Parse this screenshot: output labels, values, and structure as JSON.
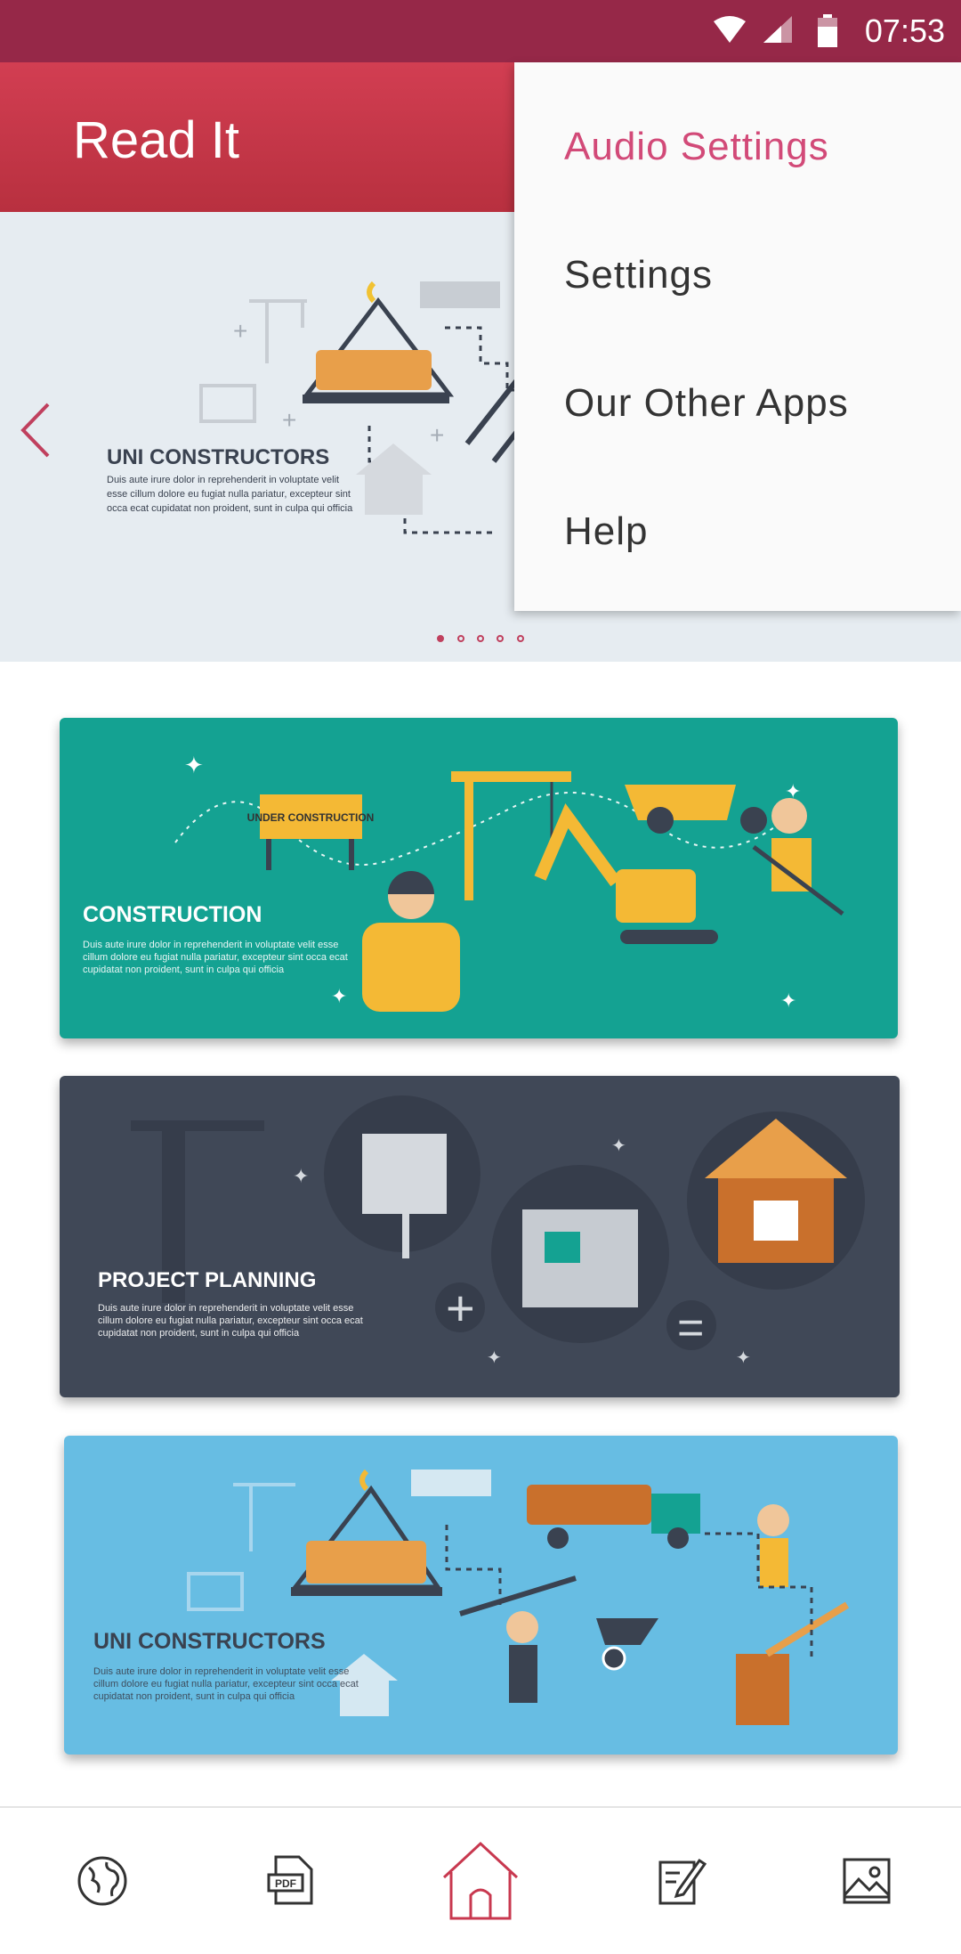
{
  "status_bar": {
    "time": "07:53"
  },
  "app_bar": {
    "title": "Read It"
  },
  "carousel": {
    "slide_title": "UNI CONSTRUCTORS",
    "slide_text": "Duis aute irure dolor in reprehenderit in voluptate velit esse cillum dolore eu fugiat nulla pariatur, excepteur sint occa ecat cupidatat non proident, sunt in culpa qui officia",
    "slide_count": 5,
    "active_index": 0
  },
  "banners": [
    {
      "title": "CONSTRUCTION",
      "text": "Duis aute irure dolor in reprehenderit in voluptate velit esse cillum dolore eu fugiat nulla pariatur, excepteur sint occa ecat cupidatat non proident, sunt in culpa qui officia",
      "color": "#14a292"
    },
    {
      "title": "PROJECT PLANNING",
      "text": "Duis aute irure dolor in reprehenderit in voluptate velit esse cillum dolore eu fugiat nulla pariatur, excepteur sint occa ecat cupidatat non proident, sunt in culpa qui officia",
      "color": "#404857"
    },
    {
      "title": "UNI CONSTRUCTORS",
      "text": "Duis aute irure dolor in reprehenderit in voluptate velit esse cillum dolore eu fugiat nulla pariatur, excepteur sint occa ecat cupidatat non proident, sunt in culpa qui officia",
      "color": "#67bde3"
    }
  ],
  "banner_art": {
    "under_construction_sign": "UNDER CONSTRUCTION"
  },
  "menu": {
    "items": [
      {
        "label": "Audio Settings",
        "active": true
      },
      {
        "label": "Settings"
      },
      {
        "label": "Our Other Apps"
      },
      {
        "label": "Help"
      }
    ]
  },
  "bottom_nav": {
    "items": [
      {
        "icon": "globe-icon"
      },
      {
        "icon": "pdf-icon",
        "badge": "PDF"
      },
      {
        "icon": "home-icon",
        "active": true
      },
      {
        "icon": "edit-icon"
      },
      {
        "icon": "image-icon"
      }
    ]
  },
  "colors": {
    "status_bar": "#962848",
    "app_bar": "#c5374a",
    "accent": "#d24a78",
    "nav_active": "#c8384f"
  }
}
